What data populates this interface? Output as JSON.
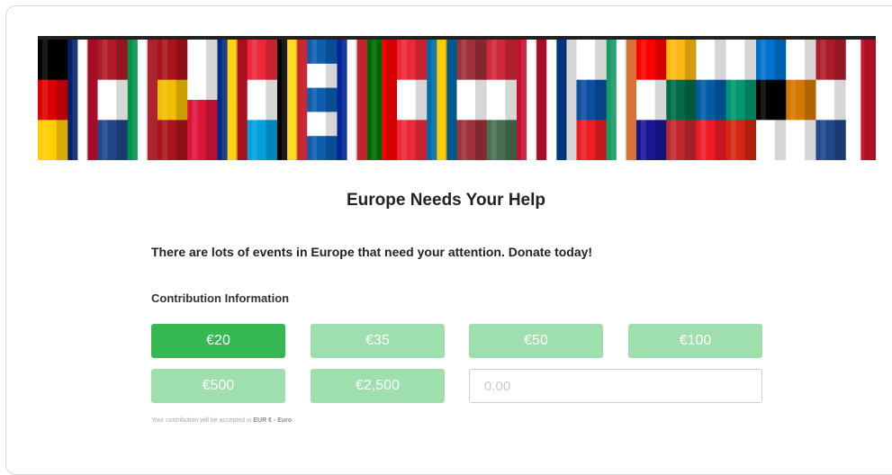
{
  "banner": {
    "flags": [
      {
        "name": "germany",
        "colors": [
          "#000000",
          "#dd0000",
          "#ffce00"
        ],
        "dir": "h"
      },
      {
        "name": "united-kingdom",
        "colors": [
          "#012169",
          "#ffffff",
          "#c8102e"
        ],
        "dir": "v"
      },
      {
        "name": "netherlands",
        "colors": [
          "#ae1c28",
          "#ffffff",
          "#21468b"
        ],
        "dir": "h"
      },
      {
        "name": "italy",
        "colors": [
          "#009246",
          "#ffffff",
          "#ce2b37"
        ],
        "dir": "v"
      },
      {
        "name": "spain",
        "colors": [
          "#aa151b",
          "#f1bf00",
          "#aa151b"
        ],
        "dir": "h"
      },
      {
        "name": "poland",
        "colors": [
          "#ffffff",
          "#dc143c"
        ],
        "dir": "h"
      },
      {
        "name": "romania",
        "colors": [
          "#002b7f",
          "#fcd116",
          "#ce1126"
        ],
        "dir": "v"
      },
      {
        "name": "luxembourg",
        "colors": [
          "#ed2939",
          "#ffffff",
          "#00a1de"
        ],
        "dir": "h"
      },
      {
        "name": "belgium",
        "colors": [
          "#000000",
          "#fdda24",
          "#ef3340"
        ],
        "dir": "v"
      },
      {
        "name": "greece",
        "colors": [
          "#0d5eaf",
          "#ffffff",
          "#0d5eaf",
          "#ffffff",
          "#0d5eaf"
        ],
        "dir": "h"
      },
      {
        "name": "france",
        "colors": [
          "#002395",
          "#ffffff",
          "#ed2939"
        ],
        "dir": "v"
      },
      {
        "name": "portugal",
        "colors": [
          "#006600",
          "#ff0000"
        ],
        "dir": "v"
      },
      {
        "name": "austria",
        "colors": [
          "#ed2939",
          "#ffffff",
          "#ed2939"
        ],
        "dir": "h"
      },
      {
        "name": "sweden",
        "colors": [
          "#006aa7",
          "#fecc00",
          "#006aa7"
        ],
        "dir": "v"
      },
      {
        "name": "latvia",
        "colors": [
          "#9e3039",
          "#ffffff",
          "#9e3039"
        ],
        "dir": "h"
      },
      {
        "name": "hungary",
        "colors": [
          "#ce2939",
          "#ffffff",
          "#477050"
        ],
        "dir": "h"
      },
      {
        "name": "denmark",
        "colors": [
          "#c8102e",
          "#ffffff",
          "#c8102e"
        ],
        "dir": "v"
      },
      {
        "name": "finland",
        "colors": [
          "#ffffff",
          "#003580",
          "#ffffff"
        ],
        "dir": "v"
      },
      {
        "name": "slovakia",
        "colors": [
          "#ffffff",
          "#0b4ea2",
          "#ee1c25"
        ],
        "dir": "h"
      },
      {
        "name": "ireland",
        "colors": [
          "#169b62",
          "#ffffff",
          "#ff883e"
        ],
        "dir": "v"
      },
      {
        "name": "croatia",
        "colors": [
          "#ff0000",
          "#ffffff",
          "#171796"
        ],
        "dir": "h"
      },
      {
        "name": "lithuania",
        "colors": [
          "#fdb913",
          "#006a44",
          "#c1272d"
        ],
        "dir": "h"
      },
      {
        "name": "slovenia",
        "colors": [
          "#ffffff",
          "#005da4",
          "#ed1c24"
        ],
        "dir": "h"
      },
      {
        "name": "bulgaria",
        "colors": [
          "#ffffff",
          "#00966e",
          "#d62612"
        ],
        "dir": "h"
      },
      {
        "name": "estonia",
        "colors": [
          "#0072ce",
          "#000000",
          "#ffffff"
        ],
        "dir": "h"
      },
      {
        "name": "cyprus",
        "colors": [
          "#ffffff",
          "#d57800",
          "#ffffff"
        ],
        "dir": "h"
      },
      {
        "name": "netherlands-2",
        "colors": [
          "#ae1c28",
          "#ffffff",
          "#21468b"
        ],
        "dir": "h"
      },
      {
        "name": "malta",
        "colors": [
          "#ffffff",
          "#cf142b"
        ],
        "dir": "v"
      }
    ]
  },
  "page": {
    "title": "Europe Needs Your Help",
    "intro": "There are lots of events in Europe that need your attention. Donate today!",
    "section_label": "Contribution Information"
  },
  "amounts": [
    {
      "label": "€20",
      "selected": true
    },
    {
      "label": "€35",
      "selected": false
    },
    {
      "label": "€50",
      "selected": false
    },
    {
      "label": "€100",
      "selected": false
    },
    {
      "label": "€500",
      "selected": false
    },
    {
      "label": "€2,500",
      "selected": false
    }
  ],
  "custom_amount": {
    "placeholder": "0.00",
    "value": ""
  },
  "currency_note": {
    "prefix": "Your contribution will be accepted in",
    "currency": "EUR € - Euro"
  },
  "colors": {
    "selected": "#35b751",
    "unselected": "#9fdfad"
  }
}
